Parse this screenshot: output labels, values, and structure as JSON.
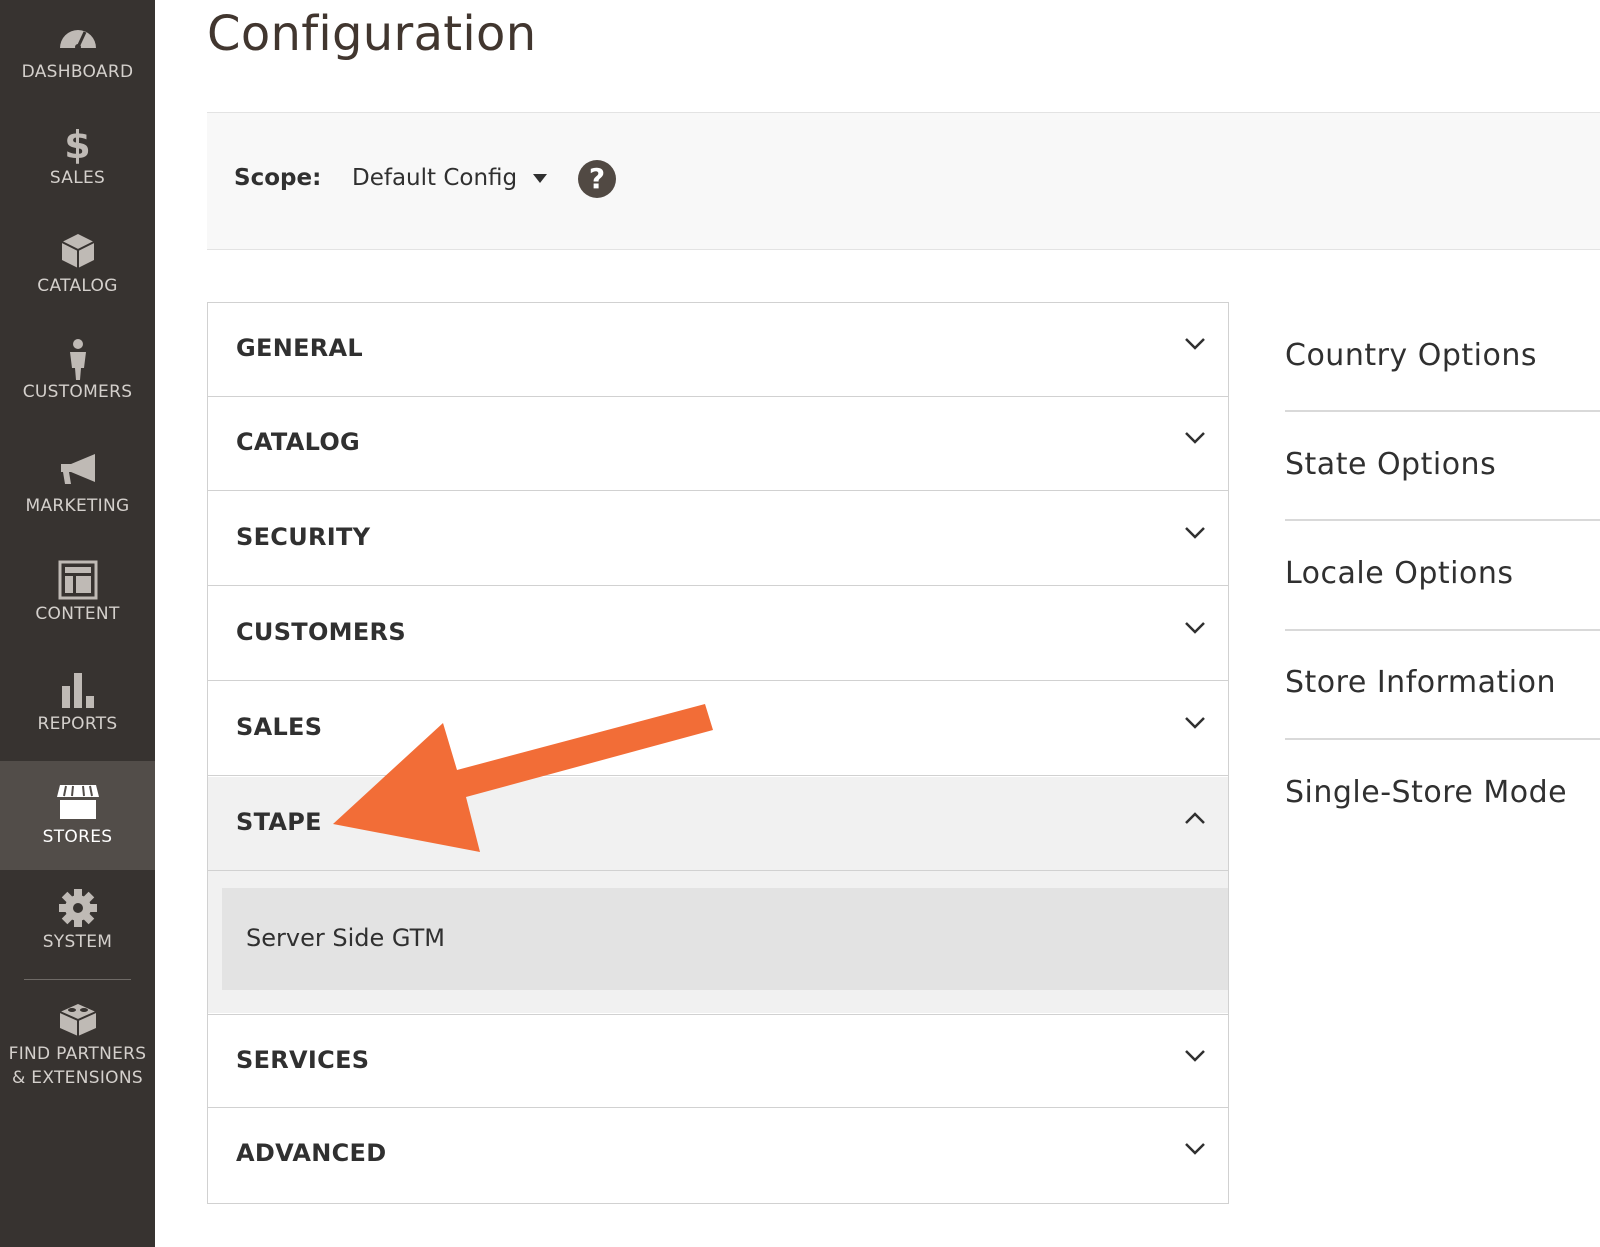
{
  "sidebar": {
    "items": [
      {
        "label": "DASHBOARD",
        "icon": "dashboard-icon"
      },
      {
        "label": "SALES",
        "icon": "dollar-icon"
      },
      {
        "label": "CATALOG",
        "icon": "box-icon"
      },
      {
        "label": "CUSTOMERS",
        "icon": "person-icon"
      },
      {
        "label": "MARKETING",
        "icon": "megaphone-icon"
      },
      {
        "label": "CONTENT",
        "icon": "layout-icon"
      },
      {
        "label": "REPORTS",
        "icon": "bar-chart-icon"
      },
      {
        "label": "STORES",
        "icon": "storefront-icon",
        "active": true
      },
      {
        "label": "SYSTEM",
        "icon": "gear-icon"
      },
      {
        "label_line1": "FIND PARTNERS",
        "label_line2": "& EXTENSIONS",
        "icon": "lego-brick-icon"
      }
    ]
  },
  "page": {
    "title": "Configuration"
  },
  "scope": {
    "label": "Scope:",
    "value": "Default Config",
    "help_symbol": "?"
  },
  "tabs": [
    {
      "label": "GENERAL",
      "state": "collapsed"
    },
    {
      "label": "CATALOG",
      "state": "collapsed"
    },
    {
      "label": "SECURITY",
      "state": "collapsed"
    },
    {
      "label": "CUSTOMERS",
      "state": "collapsed"
    },
    {
      "label": "SALES",
      "state": "collapsed"
    },
    {
      "label": "STAPE",
      "state": "expanded",
      "items": [
        {
          "label": "Server Side GTM"
        }
      ]
    },
    {
      "label": "SERVICES",
      "state": "collapsed"
    },
    {
      "label": "ADVANCED",
      "state": "collapsed"
    }
  ],
  "sections": [
    {
      "label": "Country Options"
    },
    {
      "label": "State Options"
    },
    {
      "label": "Locale Options"
    },
    {
      "label": "Store Information"
    },
    {
      "label": "Single-Store Mode"
    }
  ],
  "colors": {
    "sidebar_bg": "#373330",
    "sidebar_active": "#524d49",
    "arrow": "#f26d37",
    "title": "#41362f"
  }
}
